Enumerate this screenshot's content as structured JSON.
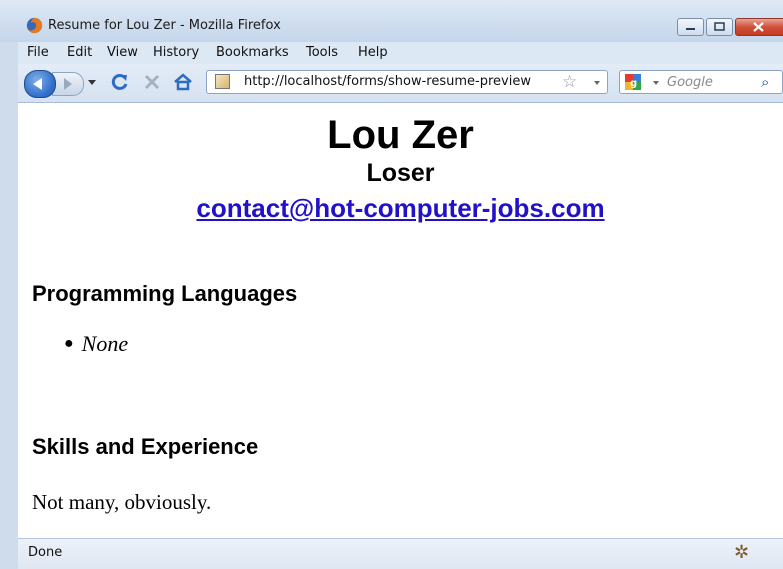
{
  "window": {
    "title": "Resume for Lou Zer - Mozilla Firefox"
  },
  "menubar": {
    "items": [
      "File",
      "Edit",
      "View",
      "History",
      "Bookmarks",
      "Tools",
      "Help"
    ]
  },
  "navbar": {
    "url": "http://localhost/forms/show-resume-preview",
    "search_placeholder": "Google"
  },
  "page": {
    "name": "Lou Zer",
    "subtitle": "Loser",
    "email": "contact@hot-computer-jobs.com",
    "section1_heading": "Programming Languages",
    "languages": [
      "None"
    ],
    "section2_heading": "Skills and Experience",
    "skills_text": "Not many, obviously."
  },
  "statusbar": {
    "status": "Done"
  },
  "colors": {
    "chrome": "#cfdcec",
    "link": "#2111c7",
    "close_button": "#c43a22"
  },
  "icons": [
    "firefox-icon",
    "back-icon",
    "forward-icon",
    "reload-icon",
    "stop-icon",
    "home-icon",
    "page-icon",
    "bookmark-star-icon",
    "google-icon",
    "search-icon",
    "bug-icon"
  ]
}
